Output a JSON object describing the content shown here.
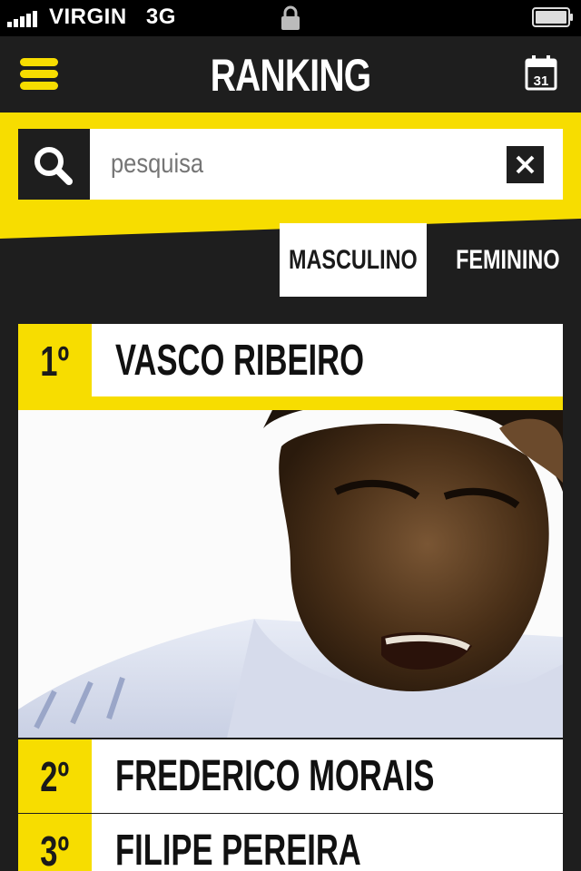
{
  "status_bar": {
    "carrier": "VIRGIN",
    "network": "3G"
  },
  "header": {
    "title": "RANKING",
    "calendar_day": "31"
  },
  "search": {
    "placeholder": "pesquisa",
    "value": ""
  },
  "tabs": [
    {
      "label": "MASCULINO",
      "active": true
    },
    {
      "label": "FEMININO",
      "active": false
    }
  ],
  "ranking": [
    {
      "position": "1º",
      "name": "VASCO RIBEIRO"
    },
    {
      "position": "2º",
      "name": "FREDERICO MORAIS"
    },
    {
      "position": "3º",
      "name": "FILIPE PEREIRA"
    }
  ],
  "colors": {
    "accent": "#f7dd00",
    "dark": "#1e1e1e",
    "white": "#ffffff"
  },
  "icons": {
    "menu": "hamburger-icon",
    "calendar": "calendar-icon",
    "search": "search-icon",
    "clear": "close-icon",
    "lock": "lock-icon",
    "battery": "battery-icon",
    "signal": "signal-icon"
  }
}
